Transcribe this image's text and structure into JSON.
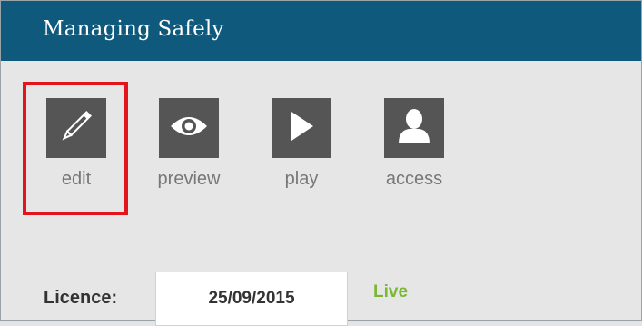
{
  "header": {
    "title": "Managing Safely"
  },
  "toolbar": {
    "items": [
      {
        "label": "edit",
        "icon": "pencil-icon"
      },
      {
        "label": "preview",
        "icon": "eye-icon"
      },
      {
        "label": "play",
        "icon": "play-icon"
      },
      {
        "label": "access",
        "icon": "user-icon"
      }
    ]
  },
  "licence": {
    "label": "Licence:",
    "date": "25/09/2015",
    "status": "Live"
  },
  "colors": {
    "header_bg": "#0f5a7c",
    "tile_bg": "#555555",
    "highlight": "#e3141b",
    "status": "#7ab833"
  }
}
